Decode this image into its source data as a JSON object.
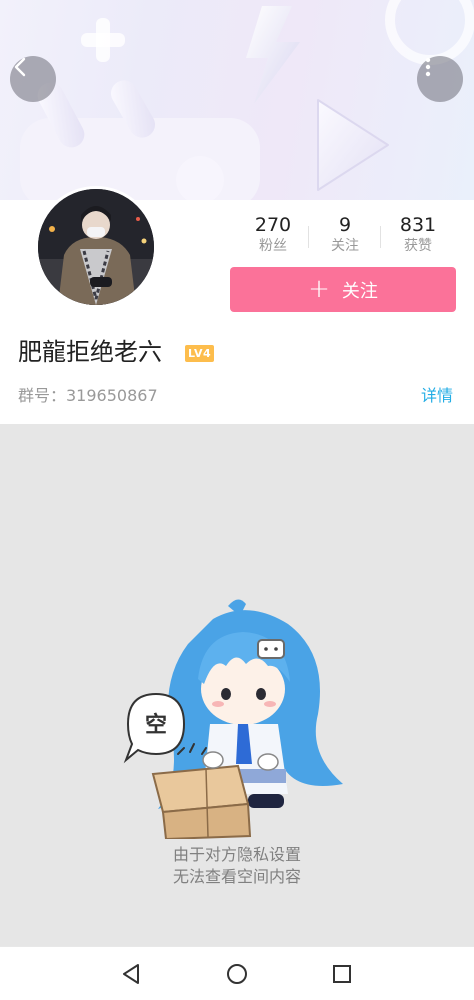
{
  "header": {
    "back_icon": "chevron-left-icon",
    "more_icon": "vertical-ellipsis-icon"
  },
  "profile": {
    "stats": [
      {
        "value": "270",
        "label": "粉丝"
      },
      {
        "value": "9",
        "label": "关注"
      },
      {
        "value": "831",
        "label": "获赞"
      }
    ],
    "follow_button": {
      "icon": "plus-icon",
      "icon_glyph": "+",
      "label": "关注"
    },
    "username": "肥龍拒绝老六",
    "level_badge": "LV4",
    "group_line": "群号：319650867",
    "details_link": "详情"
  },
  "empty_state": {
    "speech_bubble": "空",
    "line1": "由于对方隐私设置",
    "line2": "无法查看空间内容"
  },
  "colors": {
    "accent_pink": "#fb7299",
    "link_blue": "#23ade5",
    "level_badge": "#fdbd4c",
    "empty_bg": "#e6e6e6"
  },
  "navbar": {
    "icons": [
      "back-triangle-icon",
      "home-circle-icon",
      "recents-square-icon"
    ]
  }
}
